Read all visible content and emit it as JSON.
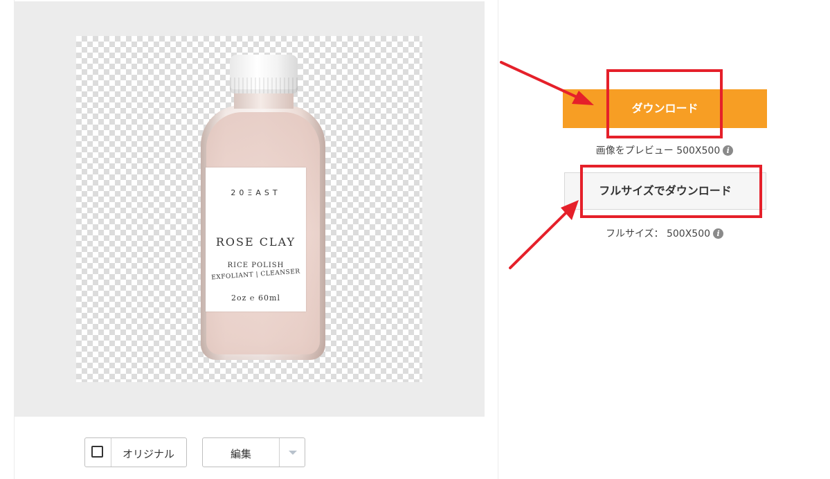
{
  "preview": {
    "product_image": {
      "brand": "20ΞAST",
      "name": "ROSE CLAY",
      "line1": "RICE POLISH",
      "line2": "EXFOLIANT | CLEANSER",
      "size": "2oz ℮ 60ml"
    }
  },
  "controls": {
    "original_label": "オリジナル",
    "original_checked": false,
    "edit_label": "編集"
  },
  "download": {
    "button_label": "ダウンロード",
    "preview_text": "画像をプレビュー 500X500",
    "full_button_label": "フルサイズでダウンロード",
    "full_text": "フルサイズ： 500X500"
  },
  "colors": {
    "accent": "#f79e24",
    "highlight": "#e5202a",
    "panel_bg": "#ececec"
  },
  "icons": {
    "info": "info-icon",
    "dropdown": "chevron-down-icon",
    "checkbox": "checkbox"
  }
}
